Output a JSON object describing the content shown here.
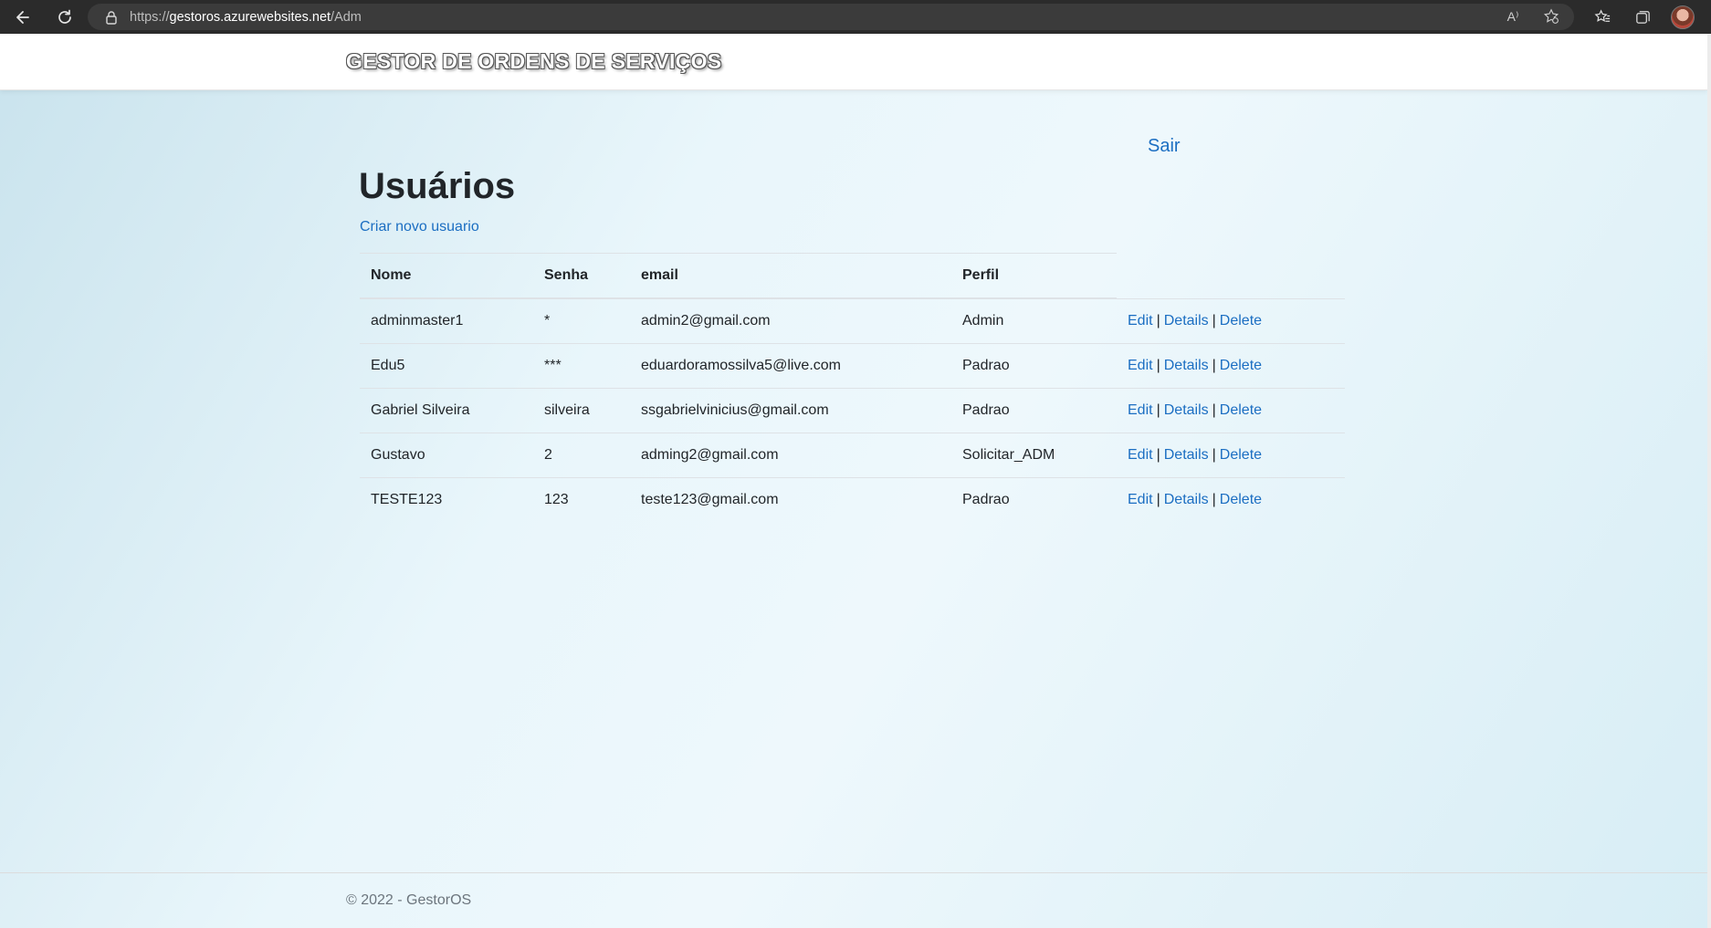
{
  "browser": {
    "url_scheme": "https://",
    "url_host": "gestoros.azurewebsites.net",
    "url_path": "/Adm",
    "read_aloud_icon": "A⁾"
  },
  "header": {
    "brand": "GESTOR DE ORDENS DE SERVIÇOS"
  },
  "nav": {
    "logout_label": "Sair"
  },
  "main": {
    "title": "Usuários",
    "create_link": "Criar novo usuario",
    "table": {
      "columns": [
        "Nome",
        "Senha",
        "email",
        "Perfil"
      ],
      "rows": [
        {
          "nome": "adminmaster1",
          "senha": "*",
          "email": "admin2@gmail.com",
          "perfil": "Admin"
        },
        {
          "nome": "Edu5",
          "senha": "***",
          "email": "eduardoramossilva5@live.com",
          "perfil": "Padrao"
        },
        {
          "nome": "Gabriel Silveira",
          "senha": "silveira",
          "email": "ssgabrielvinicius@gmail.com",
          "perfil": "Padrao"
        },
        {
          "nome": "Gustavo",
          "senha": "2",
          "email": "adming2@gmail.com",
          "perfil": "Solicitar_ADM"
        },
        {
          "nome": "TESTE123",
          "senha": "123",
          "email": "teste123@gmail.com",
          "perfil": "Padrao"
        }
      ],
      "actions": {
        "edit": "Edit",
        "details": "Details",
        "delete": "Delete",
        "separator": "|"
      }
    }
  },
  "footer": {
    "text": "© 2022 - GestorOS"
  },
  "colors": {
    "link": "#1b6ec2",
    "text": "#212529",
    "muted": "#6c757d",
    "chrome": "#2b2b2b"
  }
}
